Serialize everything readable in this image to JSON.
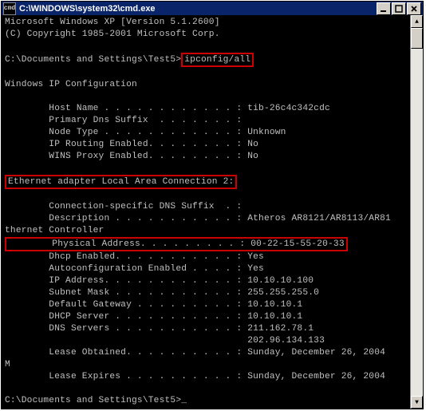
{
  "window": {
    "icon_label": "cmd",
    "title": "C:\\WINDOWS\\system32\\cmd.exe"
  },
  "header": {
    "line1": "Microsoft Windows XP [Version 5.1.2600]",
    "line2": "(C) Copyright 1985-2001 Microsoft Corp."
  },
  "prompt1": {
    "path": "C:\\Documents and Settings\\Test5>",
    "cmd": "ipconfig/all"
  },
  "section_ip_title": "Windows IP Configuration",
  "ipcfg": {
    "hostname_label": "        Host Name . . . . . . . . . . . . : ",
    "hostname_value": "tib-26c4c342cdc",
    "dnssuffix_label": "        Primary Dns Suffix  . . . . . . . :",
    "nodetype_label": "        Node Type . . . . . . . . . . . . : ",
    "nodetype_value": "Unknown",
    "iprouting_label": "        IP Routing Enabled. . . . . . . . : ",
    "iprouting_value": "No",
    "winsproxy_label": "        WINS Proxy Enabled. . . . . . . . : ",
    "winsproxy_value": "No"
  },
  "adapter_title": "Ethernet adapter Local Area Connection 2:",
  "adapter": {
    "connsuffix_label": "        Connection-specific DNS Suffix  . :",
    "desc_label": "        Description . . . . . . . . . . . : ",
    "desc_value": "Atheros AR8121/AR8113/AR81",
    "desc_cont": "thernet Controller",
    "phys_label": "        Physical Address. . . . . . . . . : ",
    "phys_value": "00-22-15-55-20-33",
    "dhcp_label": "        Dhcp Enabled. . . . . . . . . . . : ",
    "dhcp_value": "Yes",
    "autoconf_label": "        Autoconfiguration Enabled . . . . : ",
    "autoconf_value": "Yes",
    "ipaddr_label": "        IP Address. . . . . . . . . . . . : ",
    "ipaddr_value": "10.10.10.100",
    "subnet_label": "        Subnet Mask . . . . . . . . . . . : ",
    "subnet_value": "255.255.255.0",
    "gateway_label": "        Default Gateway . . . . . . . . . : ",
    "gateway_value": "10.10.10.1",
    "dhcpsrv_label": "        DHCP Server . . . . . . . . . . . : ",
    "dhcpsrv_value": "10.10.10.1",
    "dns_label": "        DNS Servers . . . . . . . . . . . : ",
    "dns_value1": "211.162.78.1",
    "dns_value2_pad": "                                            ",
    "dns_value2": "202.96.134.133",
    "leaseobt_label": "        Lease Obtained. . . . . . . . . . : ",
    "leaseobt_value": "Sunday, December 26, 2004",
    "m_line": "M",
    "leaseexp_label": "        Lease Expires . . . . . . . . . . : ",
    "leaseexp_value": "Sunday, December 26, 2004"
  },
  "prompt2": {
    "path": "C:\\Documents and Settings\\Test5>",
    "cursor": "_"
  },
  "colors": {
    "highlight_border": "#c00",
    "terminal_fg": "#c0c0c0",
    "terminal_bg": "#000",
    "titlebar_bg": "#0a246a"
  }
}
